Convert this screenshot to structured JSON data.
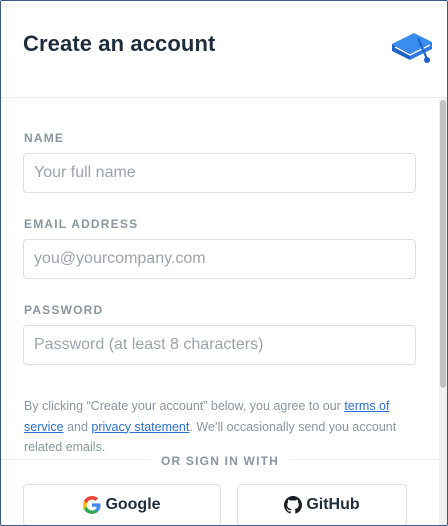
{
  "header": {
    "title": "Create an account",
    "logo_icon": "book-logo-icon",
    "accent_color": "#2d7be5"
  },
  "form": {
    "name": {
      "label": "NAME",
      "placeholder": "Your full name",
      "value": ""
    },
    "email": {
      "label": "EMAIL ADDRESS",
      "placeholder": "you@yourcompany.com",
      "value": ""
    },
    "password": {
      "label": "PASSWORD",
      "placeholder": "Password (at least 8 characters)",
      "value": ""
    }
  },
  "terms": {
    "prefix": "By clicking “Create your account” below, you agree to our ",
    "terms_link": "terms of service",
    "middle": " and ",
    "privacy_link": "privacy statement",
    "suffix": ". We’ll occasionally send you account related emails.",
    "link_color": "#2b6fd1"
  },
  "social": {
    "divider_text": "OR SIGN IN WITH",
    "google_label": "Google",
    "google_icon": "google-icon",
    "github_label": "GitHub",
    "github_icon": "github-icon"
  }
}
